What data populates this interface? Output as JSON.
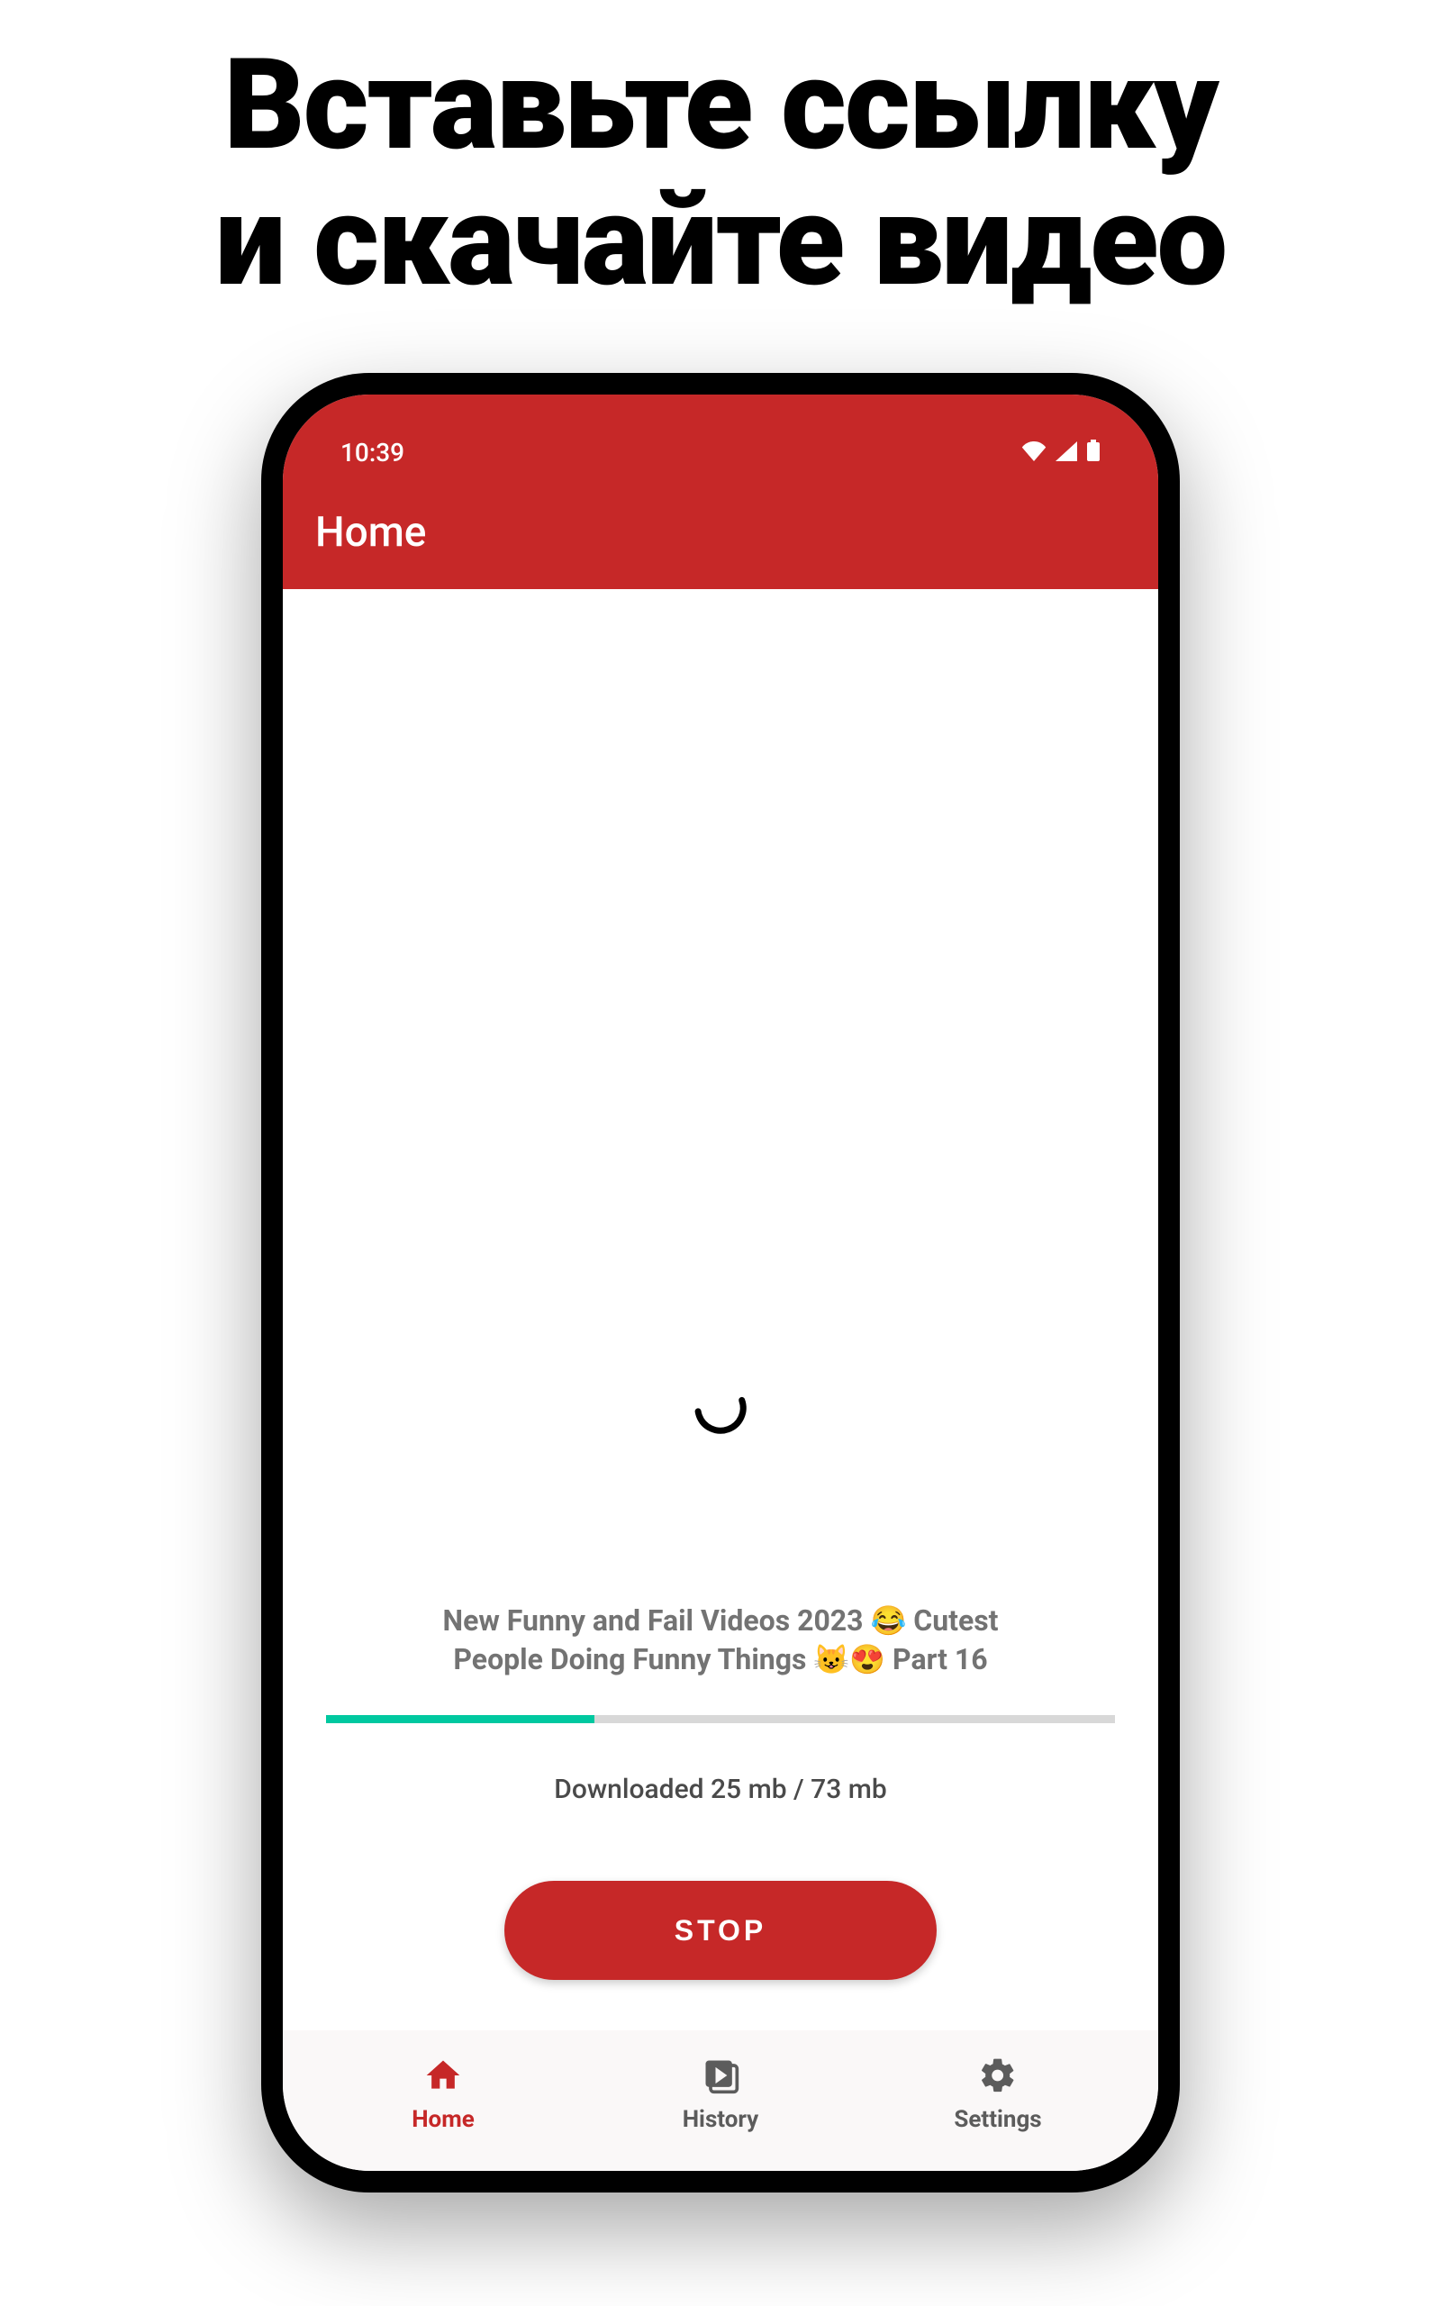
{
  "headline": {
    "line1": "Вставьте ссылку",
    "line2": "и скачайте видео"
  },
  "statusbar": {
    "time": "10:39"
  },
  "appbar": {
    "title": "Home"
  },
  "download": {
    "video_title": "New Funny and Fail Videos 2023 😂 Cutest People Doing Funny Things 😺😍 Part 16",
    "status_text": "Downloaded 25 mb / 73 mb",
    "progress_percent": 34,
    "stop_label": "STOP"
  },
  "bottom_nav": {
    "items": [
      {
        "label": "Home"
      },
      {
        "label": "History"
      },
      {
        "label": "Settings"
      }
    ]
  },
  "colors": {
    "accent_red": "#c62828",
    "progress_teal": "#00c8a0"
  }
}
